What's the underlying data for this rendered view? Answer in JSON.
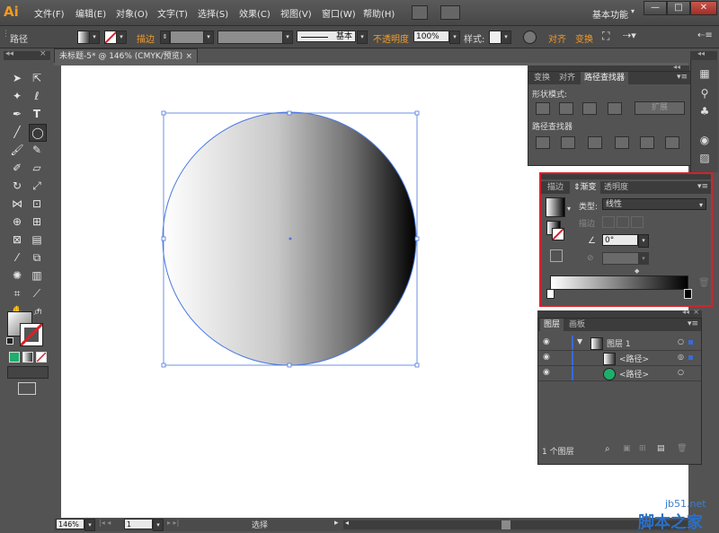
{
  "app": {
    "logo": "Ai"
  },
  "menu": [
    "文件(F)",
    "编辑(E)",
    "对象(O)",
    "文字(T)",
    "选择(S)",
    "效果(C)",
    "视图(V)",
    "窗口(W)",
    "帮助(H)"
  ],
  "workspace": {
    "label": "基本功能"
  },
  "window_controls": {
    "minimize": "—",
    "maximize": "□",
    "close": "✕"
  },
  "control_bar": {
    "selection_label": "路径",
    "stroke_label": "描边",
    "stroke_style": "基本",
    "opacity_label": "不透明度",
    "opacity_value": "100%",
    "style_label": "样式:",
    "align_label": "对齐",
    "transform_label": "变换"
  },
  "document": {
    "tab_title": "未标题-5* @ 146% (CMYK/预览)",
    "close": "×"
  },
  "pathfinder_panel": {
    "tabs": [
      "变换",
      "对齐",
      "路径查找器"
    ],
    "shape_modes_label": "形状模式:",
    "expand_button": "扩展",
    "pathfinders_label": "路径查找器"
  },
  "gradient_panel": {
    "tabs": [
      "描边",
      "渐变",
      "透明度"
    ],
    "type_label": "类型:",
    "type_value": "线性",
    "stroke_label": "描边",
    "angle_value": "0°"
  },
  "layers_panel": {
    "tabs": [
      "图层",
      "画板"
    ],
    "rows": [
      {
        "name": "图层 1"
      },
      {
        "name": "<路径>"
      },
      {
        "name": "<路径>"
      }
    ],
    "footer_count": "1 个图层"
  },
  "statusbar": {
    "zoom": "146%",
    "page": "1",
    "status_text": "选择"
  },
  "watermark": {
    "site": "jb51.net",
    "brand": "脚本之家"
  },
  "colors": {
    "accent_orange": "#f39c2b",
    "highlight_red": "#d9202a",
    "layer_blue": "#3a6ad9",
    "swatch_green": "#1fae6b"
  }
}
